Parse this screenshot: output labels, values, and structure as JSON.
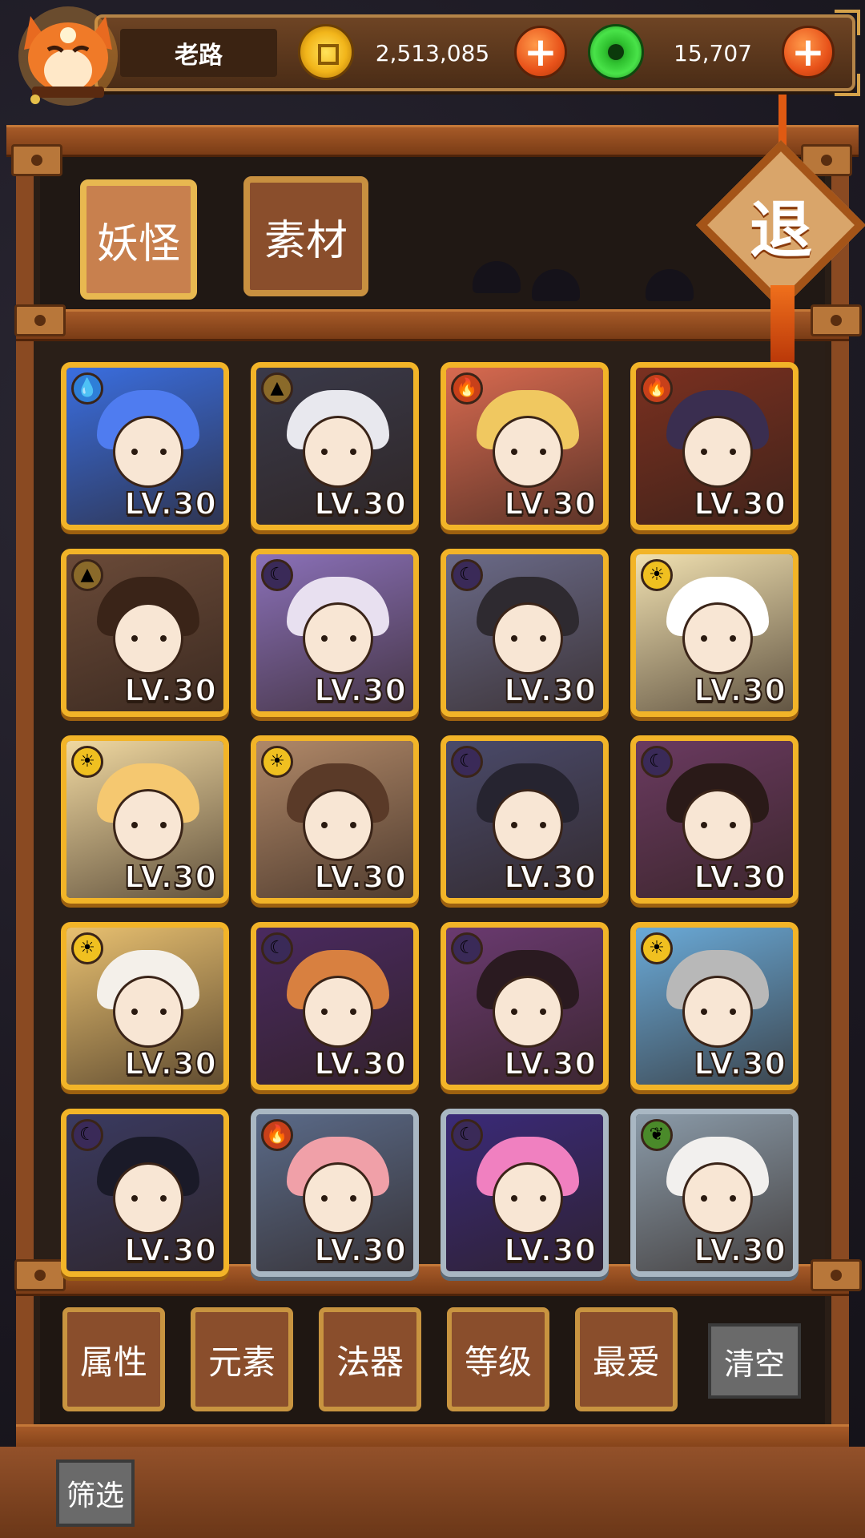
{
  "player": {
    "name": "老路",
    "gold": "2,513,085",
    "jade": "15,707"
  },
  "tabs": {
    "monster": "妖怪",
    "material": "素材",
    "exit": "退"
  },
  "cards": [
    {
      "level": "LV.30",
      "element": "water-icon",
      "frame": "gold",
      "color": "#3a6ee0",
      "hair": "#4f7cf0"
    },
    {
      "level": "LV.30",
      "element": "earth-icon",
      "frame": "gold",
      "color": "#3a3a4a",
      "hair": "#e8e8ee"
    },
    {
      "level": "LV.30",
      "element": "fire-icon",
      "frame": "gold",
      "color": "#d86a50",
      "hair": "#f0c860"
    },
    {
      "level": "LV.30",
      "element": "fire-icon",
      "frame": "gold",
      "color": "#7a3020",
      "hair": "#3a2e50"
    },
    {
      "level": "LV.30",
      "element": "earth-icon",
      "frame": "gold",
      "color": "#6a4a38",
      "hair": "#3a2418"
    },
    {
      "level": "LV.30",
      "element": "moon-icon",
      "frame": "gold",
      "color": "#8a70b8",
      "hair": "#e8e0f0"
    },
    {
      "level": "LV.30",
      "element": "moon-icon",
      "frame": "gold",
      "color": "#6a6a88",
      "hair": "#2e2a30"
    },
    {
      "level": "LV.30",
      "element": "sun-icon",
      "frame": "gold",
      "color": "#f0e0b0",
      "hair": "#ffffff"
    },
    {
      "level": "LV.30",
      "element": "sun-icon",
      "frame": "gold",
      "color": "#f0d8a0",
      "hair": "#f5c870"
    },
    {
      "level": "LV.30",
      "element": "sun-icon",
      "frame": "gold",
      "color": "#b08868",
      "hair": "#5a3a28"
    },
    {
      "level": "LV.30",
      "element": "moon-icon",
      "frame": "gold",
      "color": "#4a4a6a",
      "hair": "#262430"
    },
    {
      "level": "LV.30",
      "element": "moon-icon",
      "frame": "gold",
      "color": "#6a3a60",
      "hair": "#2a1a18"
    },
    {
      "level": "LV.30",
      "element": "sun-icon",
      "frame": "gold",
      "color": "#e8c070",
      "hair": "#f4f0ea"
    },
    {
      "level": "LV.30",
      "element": "moon-icon",
      "frame": "gold",
      "color": "#4a2a60",
      "hair": "#d88040"
    },
    {
      "level": "LV.30",
      "element": "moon-icon",
      "frame": "gold",
      "color": "#6a3a70",
      "hair": "#2a1a20"
    },
    {
      "level": "LV.30",
      "element": "sun-icon",
      "frame": "gold",
      "color": "#6aaad8",
      "hair": "#b8b8b8"
    },
    {
      "level": "LV.30",
      "element": "moon-icon",
      "frame": "gold",
      "color": "#3a3a60",
      "hair": "#1a1a28"
    },
    {
      "level": "LV.30",
      "element": "fire-icon",
      "frame": "silver",
      "color": "#5a6a88",
      "hair": "#f0a0a8"
    },
    {
      "level": "LV.30",
      "element": "moon-icon",
      "frame": "silver",
      "color": "#3a2a78",
      "hair": "#f080c0"
    },
    {
      "level": "LV.30",
      "element": "leaf-icon",
      "frame": "silver",
      "color": "#8a9aa8",
      "hair": "#f2f0ee"
    }
  ],
  "filters": {
    "attribute": "属性",
    "element": "元素",
    "artifact": "法器",
    "level": "等级",
    "favorite": "最爱",
    "clear": "清空",
    "screen": "筛选"
  },
  "colors": {
    "gold_frame": "#f2b428",
    "silver_frame": "#a9b7c3",
    "wood": "#8a4a22"
  }
}
